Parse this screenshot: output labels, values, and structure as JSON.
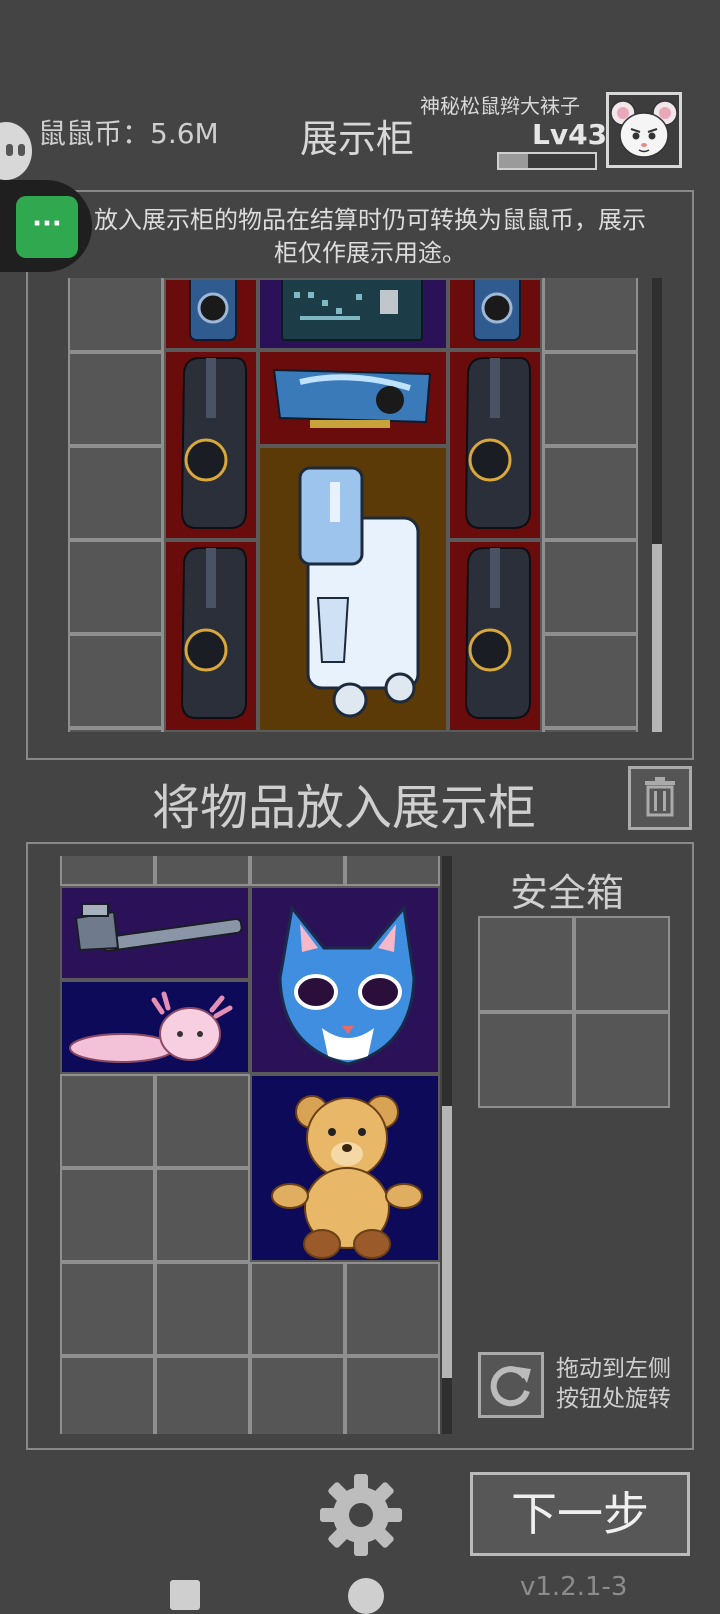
{
  "header": {
    "coins_text": "鼠鼠币：5.6M",
    "title": "展示柜",
    "username": "神秘松鼠辫大袜子",
    "level": "Lv43",
    "xp_progress": 0.3
  },
  "notice": "放入展示柜的物品在结算时仍可转换为鼠鼠币，展示柜仅作展示用途。",
  "showcase": {
    "items": [
      {
        "name": "speaker",
        "rarity": "red"
      },
      {
        "name": "circuit-board",
        "rarity": "purple"
      },
      {
        "name": "speaker",
        "rarity": "red"
      },
      {
        "name": "earbud-case",
        "rarity": "red"
      },
      {
        "name": "graphics-card",
        "rarity": "red"
      },
      {
        "name": "earbud-case",
        "rarity": "red"
      },
      {
        "name": "oxygen-concentrator",
        "rarity": "gold"
      },
      {
        "name": "earbud-case",
        "rarity": "red"
      },
      {
        "name": "earbud-case",
        "rarity": "red"
      }
    ]
  },
  "place_label": "将物品放入展示柜",
  "inventory": {
    "items": [
      {
        "name": "pipe-wrench",
        "rarity": "purple"
      },
      {
        "name": "axolotl-plush",
        "rarity": "navy"
      },
      {
        "name": "cat-mask",
        "rarity": "purple"
      },
      {
        "name": "teddy-bear",
        "rarity": "navy"
      }
    ]
  },
  "safebox": {
    "title": "安全箱"
  },
  "rotate": {
    "hint": [
      "拖动到左侧",
      "按钮处旋转"
    ]
  },
  "footer": {
    "next_label": "下一步",
    "version": "v1.2.1-3"
  },
  "colors": {
    "bg": "#444444",
    "red_rarity": "#6b0c0c",
    "purple_rarity": "#2b1158",
    "gold_rarity": "#5c3a08",
    "navy_rarity": "#0d0a5a",
    "chat_green": "#2fa84f"
  }
}
